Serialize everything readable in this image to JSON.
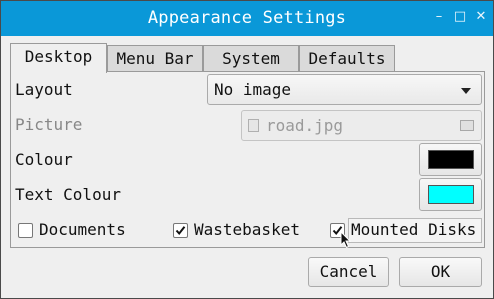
{
  "window": {
    "title": "Appearance Settings",
    "controls": {
      "minimize": "–",
      "maximize": "□",
      "close": "✕"
    },
    "accent_color": "#0a98d8"
  },
  "tabs": [
    {
      "label": "Desktop",
      "active": true
    },
    {
      "label": "Menu Bar",
      "active": false
    },
    {
      "label": "System",
      "active": false
    },
    {
      "label": "Defaults",
      "active": false
    }
  ],
  "form": {
    "layout": {
      "label": "Layout",
      "value": "No image"
    },
    "picture": {
      "label": "Picture",
      "value": "road.jpg",
      "enabled": false
    },
    "colour": {
      "label": "Colour",
      "swatch": "#000000"
    },
    "text_colour": {
      "label": "Text Colour",
      "swatch": "#00ffff"
    },
    "checkboxes": [
      {
        "label": "Documents",
        "checked": false
      },
      {
        "label": "Wastebasket",
        "checked": true
      },
      {
        "label": "Mounted Disks",
        "checked": true
      }
    ]
  },
  "buttons": {
    "cancel": "Cancel",
    "ok": "OK"
  }
}
